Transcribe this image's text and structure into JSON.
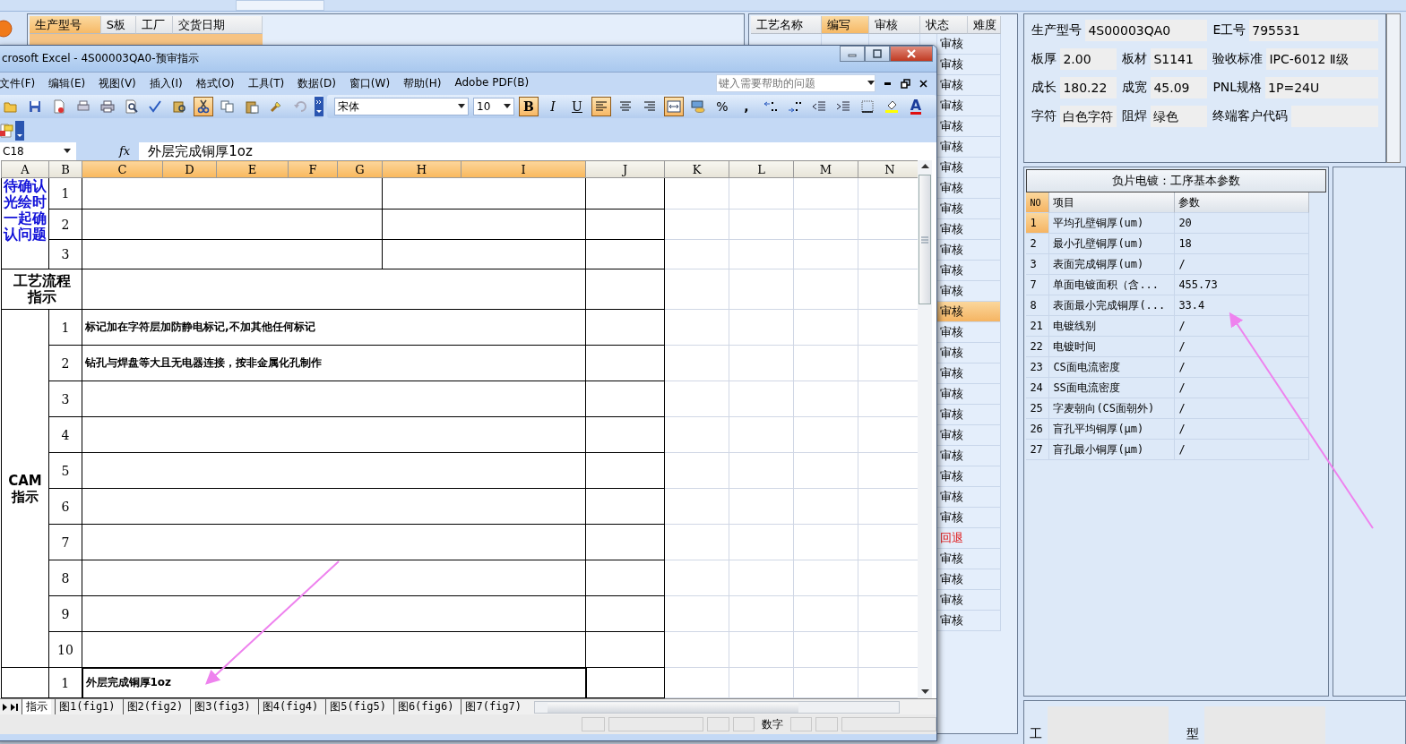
{
  "background_app": {
    "order_grid": {
      "columns": [
        {
          "label": "生产型号",
          "selected": true
        },
        {
          "label": "S板",
          "selected": false
        },
        {
          "label": "工厂",
          "selected": false
        },
        {
          "label": "交货日期",
          "selected": false
        }
      ]
    },
    "process_grid": {
      "columns": [
        {
          "label": "工艺名称",
          "selected": false
        },
        {
          "label": "编写",
          "selected": true
        },
        {
          "label": "审核",
          "selected": false
        },
        {
          "label": "状态",
          "selected": false
        },
        {
          "label": "难度",
          "selected": false
        }
      ],
      "rows": [
        {
          "status": "审核",
          "kind": "approved",
          "selected": false
        },
        {
          "status": "审核",
          "kind": "approved",
          "selected": false
        },
        {
          "status": "审核",
          "kind": "approved",
          "selected": false
        },
        {
          "status": "审核",
          "kind": "approved",
          "selected": false
        },
        {
          "status": "审核",
          "kind": "approved",
          "selected": false
        },
        {
          "status": "审核",
          "kind": "approved",
          "selected": false
        },
        {
          "status": "审核",
          "kind": "approved",
          "selected": false
        },
        {
          "status": "审核",
          "kind": "approved",
          "selected": false
        },
        {
          "status": "审核",
          "kind": "approved",
          "selected": false
        },
        {
          "status": "审核",
          "kind": "approved",
          "selected": false
        },
        {
          "status": "审核",
          "kind": "approved",
          "selected": false
        },
        {
          "status": "审核",
          "kind": "approved",
          "selected": false
        },
        {
          "status": "审核",
          "kind": "approved",
          "selected": false
        },
        {
          "status": "审核",
          "kind": "approved",
          "selected": true
        },
        {
          "status": "审核",
          "kind": "approved",
          "selected": false
        },
        {
          "status": "审核",
          "kind": "approved",
          "selected": false
        },
        {
          "status": "审核",
          "kind": "approved",
          "selected": false
        },
        {
          "status": "审核",
          "kind": "approved",
          "selected": false
        },
        {
          "status": "审核",
          "kind": "approved",
          "selected": false
        },
        {
          "status": "审核",
          "kind": "approved",
          "selected": false
        },
        {
          "status": "审核",
          "kind": "approved",
          "selected": false
        },
        {
          "status": "审核",
          "kind": "approved",
          "selected": false
        },
        {
          "status": "审核",
          "kind": "approved",
          "selected": false
        },
        {
          "status": "审核",
          "kind": "approved",
          "selected": false
        },
        {
          "status": "回退",
          "kind": "returned",
          "selected": false
        },
        {
          "status": "审核",
          "kind": "approved",
          "selected": false
        },
        {
          "status": "审核",
          "kind": "approved",
          "selected": false
        },
        {
          "status": "审核",
          "kind": "approved",
          "selected": false
        },
        {
          "status": "审核",
          "kind": "approved",
          "selected": false
        }
      ]
    },
    "info_panel": {
      "fields": [
        {
          "label": "生产型号",
          "value": "4S00003QA0"
        },
        {
          "label": "E工号",
          "value": "795531"
        },
        {
          "label": "板厚",
          "value": "2.00"
        },
        {
          "label": "板材",
          "value": "S1141"
        },
        {
          "label": "验收标准",
          "value": "IPC-6012 Ⅱ级"
        },
        {
          "label": "成长",
          "value": "180.22"
        },
        {
          "label": "成宽",
          "value": "45.09"
        },
        {
          "label": "PNL规格",
          "value": "1P=24U"
        },
        {
          "label": "字符",
          "value": "白色字符"
        },
        {
          "label": "阻焊",
          "value": "绿色"
        },
        {
          "label": "终端客户代码"
        }
      ]
    },
    "param_table": {
      "title": "负片电镀：工序基本参数",
      "columns": [
        "NO",
        "项目",
        "参数"
      ],
      "rows": [
        {
          "no": "1",
          "item": "平均孔壁铜厚(um)",
          "value": "20",
          "selected": true
        },
        {
          "no": "2",
          "item": "最小孔壁铜厚(um)",
          "value": "18",
          "selected": false
        },
        {
          "no": "3",
          "item": "表面完成铜厚(um)",
          "value": "/",
          "selected": false
        },
        {
          "no": "7",
          "item": "单面电镀面积（含...",
          "value": "455.73",
          "selected": false
        },
        {
          "no": "8",
          "item": "表面最小完成铜厚(...",
          "value": "33.4",
          "selected": false
        },
        {
          "no": "21",
          "item": "电镀线别",
          "value": "/",
          "selected": false
        },
        {
          "no": "22",
          "item": "电镀时间",
          "value": "/",
          "selected": false
        },
        {
          "no": "23",
          "item": "CS面电流密度",
          "value": "/",
          "selected": false
        },
        {
          "no": "24",
          "item": "SS面电流密度",
          "value": "/",
          "selected": false
        },
        {
          "no": "25",
          "item": "字麦朝向(CS面朝外)",
          "value": "/",
          "selected": false
        },
        {
          "no": "26",
          "item": "盲孔平均铜厚(μm)",
          "value": "/",
          "selected": false
        },
        {
          "no": "27",
          "item": "盲孔最小铜厚(μm)",
          "value": "/",
          "selected": false
        }
      ]
    },
    "bottom_labels": [
      "工",
      "型"
    ]
  },
  "excel": {
    "title": "crosoft Excel - 4S00003QA0-预审指示",
    "menus": [
      "文件(F)",
      "编辑(E)",
      "视图(V)",
      "插入(I)",
      "格式(O)",
      "工具(T)",
      "数据(D)",
      "窗口(W)",
      "帮助(H)",
      "Adobe PDF(B)"
    ],
    "help_placeholder": "键入需要帮助的问题",
    "standard_toolbar": [
      {
        "kind": "open",
        "on": false
      },
      {
        "kind": "save",
        "on": false
      },
      {
        "kind": "permission",
        "on": false
      },
      {
        "kind": "mail",
        "on": false
      },
      {
        "kind": "print",
        "on": false
      },
      {
        "kind": "preview",
        "on": false
      },
      {
        "kind": "spelling",
        "on": false
      },
      {
        "kind": "research",
        "on": false
      },
      {
        "kind": "cut",
        "on": true
      },
      {
        "kind": "copy",
        "on": false
      },
      {
        "kind": "paste",
        "on": false
      },
      {
        "kind": "painter",
        "on": false
      },
      {
        "kind": "undo",
        "on": false
      }
    ],
    "font": "宋体",
    "font_size": "10",
    "format_toolbar": [
      {
        "kind": "bold",
        "label": "B",
        "on": true
      },
      {
        "kind": "italic",
        "label": "I",
        "on": false
      },
      {
        "kind": "underline",
        "label": "U",
        "on": false
      },
      {
        "kind": "align-left",
        "on": true
      },
      {
        "kind": "center",
        "on": false
      },
      {
        "kind": "align-right",
        "on": false
      },
      {
        "kind": "merge",
        "on": true
      },
      {
        "kind": "currency",
        "on": false
      },
      {
        "kind": "percent",
        "label": "%",
        "on": false
      },
      {
        "kind": "comma",
        "label": ",",
        "on": false
      },
      {
        "kind": "inc-decimal",
        "on": false
      },
      {
        "kind": "dec-decimal",
        "on": false
      },
      {
        "kind": "outdent",
        "on": false
      },
      {
        "kind": "indent",
        "on": false
      },
      {
        "kind": "borders",
        "on": false
      },
      {
        "kind": "fill-color",
        "on": false
      },
      {
        "kind": "font-color",
        "label": "A",
        "on": false
      }
    ],
    "name_box": "C18",
    "function_label": "fx",
    "formula": "外层完成铜厚1oz",
    "columns": [
      {
        "label": "A",
        "selected": false
      },
      {
        "label": "B",
        "selected": false
      },
      {
        "label": "C",
        "selected": true
      },
      {
        "label": "D",
        "selected": true
      },
      {
        "label": "E",
        "selected": true
      },
      {
        "label": "F",
        "selected": true
      },
      {
        "label": "G",
        "selected": true
      },
      {
        "label": "H",
        "selected": true
      },
      {
        "label": "I",
        "selected": true
      },
      {
        "label": "J",
        "selected": false
      },
      {
        "label": "K",
        "selected": false
      },
      {
        "label": "L",
        "selected": false
      },
      {
        "label": "M",
        "selected": false
      },
      {
        "label": "N",
        "selected": false
      }
    ],
    "confirm_section": {
      "label": "待确认光绘时一起确认问题",
      "rows": [
        "1",
        "2",
        "3"
      ]
    },
    "process_section": {
      "label": "工艺流程指示"
    },
    "cam_section": {
      "label": "CAM指示",
      "rows": [
        {
          "number": "1",
          "text": "标记加在字符层加防静电标记,不加其他任何标记"
        },
        {
          "number": "2",
          "text": "钻孔与焊盘等大且无电器连接，按非金属化孔制作"
        },
        {
          "number": "3"
        },
        {
          "number": "4"
        },
        {
          "number": "5"
        },
        {
          "number": "6"
        },
        {
          "number": "7"
        },
        {
          "number": "8"
        },
        {
          "number": "9"
        },
        {
          "number": "10"
        }
      ]
    },
    "last_row": {
      "number": "1",
      "text": "外层完成铜厚1oz",
      "selected": true
    },
    "sheet_tabs": [
      {
        "label": "指示",
        "selected": true
      },
      {
        "label": "图1(fig1)",
        "selected": false
      },
      {
        "label": "图2(fig2)",
        "selected": false
      },
      {
        "label": "图3(fig3)",
        "selected": false
      },
      {
        "label": "图4(fig4)",
        "selected": false
      },
      {
        "label": "图5(fig5)",
        "selected": false
      },
      {
        "label": "图6(fig6)",
        "selected": false
      },
      {
        "label": "图7(fig7)",
        "selected": false
      }
    ],
    "status_text": "数字"
  }
}
